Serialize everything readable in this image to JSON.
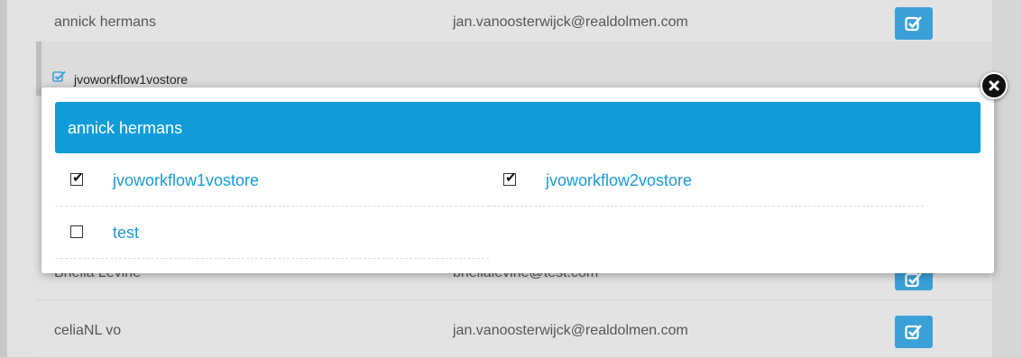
{
  "background": {
    "rows": [
      {
        "name": "annick hermans",
        "email": "jan.vanoosterwijck@realdolmen.com"
      },
      {
        "name": "Briella Levine",
        "email": "briellalevine@test.com"
      },
      {
        "name": "celiaNL vo",
        "email": "jan.vanoosterwijck@realdolmen.com"
      }
    ],
    "sub_item_label": "jvoworkflow1vostore"
  },
  "modal": {
    "title": "annick hermans",
    "options": [
      {
        "label": "jvoworkflow1vostore",
        "checked": true
      },
      {
        "label": "jvoworkflow2vostore",
        "checked": true
      },
      {
        "label": "test",
        "checked": false
      }
    ]
  },
  "colors": {
    "accent": "#109cd9",
    "link": "#1a9ad6",
    "edit_button": "#3aa0d8"
  }
}
